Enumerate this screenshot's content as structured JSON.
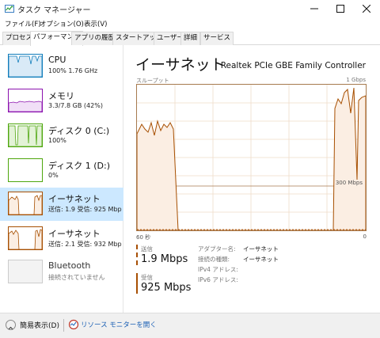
{
  "window": {
    "title": "タスク マネージャー"
  },
  "menu": [
    "ファイル(F)",
    "オプション(O)",
    "表示(V)"
  ],
  "tabs": [
    "プロセス",
    "パフォーマンス",
    "アプリの履歴",
    "スタートアップ",
    "ユーザー",
    "詳細",
    "サービス"
  ],
  "active_tab": "パフォーマンス",
  "resources": [
    {
      "title": "CPU",
      "sub": "100%  1.76 GHz",
      "color": "#117dbb"
    },
    {
      "title": "メモリ",
      "sub": "3.3/7.8 GB (42%)",
      "color": "#8b12ae"
    },
    {
      "title": "ディスク 0 (C:)",
      "sub": "100%",
      "color": "#4da60c"
    },
    {
      "title": "ディスク 1 (D:)",
      "sub": "0%",
      "color": "#4da60c"
    },
    {
      "title": "イーサネット",
      "sub": "送信: 1.9 受信: 925 Mbp",
      "color": "#a74f01"
    },
    {
      "title": "イーサネット",
      "sub": "送信: 2.1 受信: 932 Mbp",
      "color": "#a74f01"
    },
    {
      "title": "Bluetooth",
      "sub": "接続されていません",
      "color": "#aaaaaa"
    }
  ],
  "detail": {
    "title": "イーサネット",
    "adapter": "Realtek PCIe GBE Family Controller",
    "graph_label": "スループット",
    "graph_max": "1 Gbps",
    "gridline_label": "300 Mbps",
    "axis_left": "60 秒",
    "axis_right": "0",
    "send_label": "送信",
    "send_value": "1.9 Mbps",
    "recv_label": "受信",
    "recv_value": "925 Mbps",
    "properties": [
      {
        "key": "アダプター名:",
        "value": "イーサネット"
      },
      {
        "key": "接続の種類:",
        "value": "イーサネット"
      },
      {
        "key": "IPv4 アドレス:",
        "value": ""
      },
      {
        "key": "IPv6 アドレス:",
        "value": ""
      }
    ]
  },
  "footer": {
    "fewer_details": "簡易表示(D)",
    "resource_monitor": "リソース モニターを開く"
  }
}
